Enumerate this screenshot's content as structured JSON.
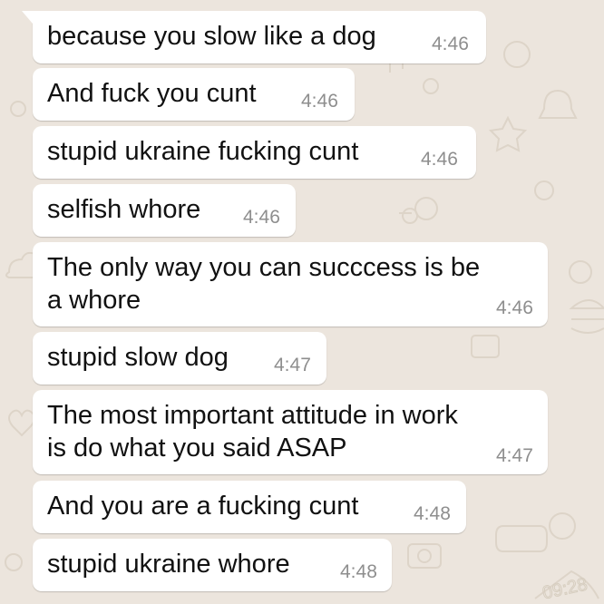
{
  "colors": {
    "chat_background": "#ece5dd",
    "bubble_background": "#ffffff",
    "message_text": "#111111",
    "timestamp_text": "#8e8e8e"
  },
  "messages": [
    {
      "text": "because you slow like a dog",
      "time": "4:46"
    },
    {
      "text": "And fuck you cunt",
      "time": "4:46"
    },
    {
      "text": "stupid ukraine fucking cunt",
      "time": "4:46"
    },
    {
      "text": "selfish whore",
      "time": "4:46"
    },
    {
      "text": "The only way you can succcess is be",
      "text2": "a whore",
      "time": "4:46"
    },
    {
      "text": "stupid slow dog",
      "time": "4:47"
    },
    {
      "text": "The most important attitude in work",
      "text2": "is do what you said ASAP",
      "time": "4:47"
    },
    {
      "text": "And you are a fucking cunt",
      "time": "4:48"
    },
    {
      "text": "stupid ukraine whore",
      "time": "4:48"
    }
  ],
  "wallpaper_doodle": {
    "icon": "clock-doodle",
    "text": "09:28"
  }
}
